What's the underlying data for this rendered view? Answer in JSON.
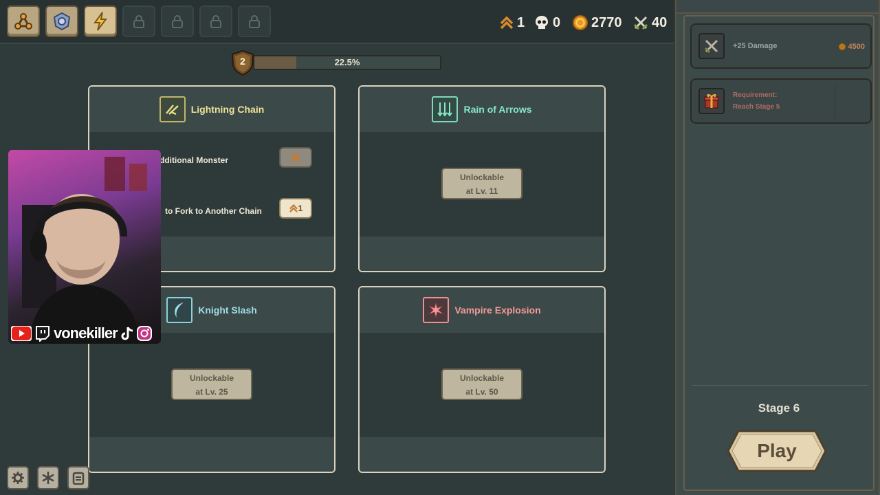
{
  "topbar": {
    "tabs": [
      {
        "name": "tree-icon",
        "state": "unlocked"
      },
      {
        "name": "shield-gem-icon",
        "state": "unlocked"
      },
      {
        "name": "lightning-icon",
        "state": "active"
      },
      {
        "name": "lock-icon",
        "state": "locked"
      },
      {
        "name": "lock-icon",
        "state": "locked"
      },
      {
        "name": "lock-icon",
        "state": "locked"
      },
      {
        "name": "lock-icon",
        "state": "locked"
      }
    ],
    "stats": {
      "rank": "1",
      "skulls": "0",
      "coins": "2770",
      "swords": "40"
    }
  },
  "xp": {
    "level": "2",
    "percent_text": "22.5%",
    "fill_fraction": 0.225
  },
  "cards": {
    "lightning": {
      "title": "Lightning Chain",
      "upgrades": [
        {
          "text": "dditional Monster",
          "cost": ""
        },
        {
          "text": "to Fork to Another Chain",
          "cost": "1"
        }
      ]
    },
    "arrows": {
      "title": "Rain of Arrows",
      "unlock_line1": "Unlockable",
      "unlock_line2": "at Lv. 11"
    },
    "knight": {
      "title": "Knight Slash",
      "unlock_line1": "Unlockable",
      "unlock_line2": "at Lv. 25"
    },
    "vampire": {
      "title": "Vampire Explosion",
      "unlock_line1": "Unlockable",
      "unlock_line2": "at Lv. 50"
    }
  },
  "webcam": {
    "handle": "vonekiller"
  },
  "side": {
    "reward1": {
      "label": "+25 Damage",
      "cost": "4500"
    },
    "reward2": {
      "line1": "Requirement:",
      "line2": "Reach Stage 5"
    },
    "stage_label": "Stage 6",
    "play_label": "Play"
  },
  "colors": {
    "lightning_title": "#efe39a",
    "arrows_title": "#86e6c6",
    "knight_title": "#9fdde8",
    "vampire_title": "#f59a9a",
    "reward_cost": "#c4855a",
    "requirement": "#b06a62"
  }
}
